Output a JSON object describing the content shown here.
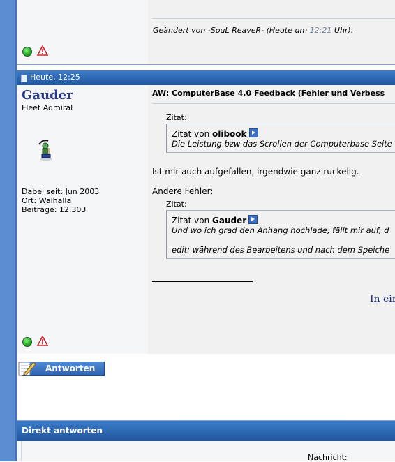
{
  "previous_post": {
    "edit_prefix": "Geändert von -SouL ReaveR- (Heute um ",
    "edit_time": "12:21",
    "edit_suffix": " Uhr)."
  },
  "post": {
    "date": "Heute, 12:25",
    "user": {
      "name": "Gauder",
      "title": "Fleet Admiral",
      "joined": "Dabei seit: Jun 2003",
      "location": "Ort: Walhalla",
      "posts": "Beiträge: 12.303"
    },
    "title": "AW: ComputerBase 4.0 Feedback (Fehler und Verbess",
    "quote1": {
      "label": "Zitat:",
      "prefix": "Zitat von ",
      "author": "olibook",
      "text": "Die Leistung bzw das Scrollen der Computerbase Seite"
    },
    "paragraph1": "Ist mir auch aufgefallen, irgendwie ganz ruckelig.",
    "paragraph2": "Andere Fehler:",
    "quote2": {
      "label": "Zitat:",
      "prefix": "Zitat von ",
      "author": "Gauder",
      "line1": "Und wo ich grad den Anhang hochlade, fällt mir auf, d",
      "line2": "edit: während des Bearbeitens und nach dem Speiche"
    },
    "signature": "In ein"
  },
  "reply_button": "Antworten",
  "direct_reply": {
    "title": "Direkt antworten",
    "message_label": "Nachricht:"
  },
  "colors": {
    "header_blue": "#20569e",
    "username": "#2b3a86",
    "status_online": "#22b022",
    "warning_red": "#d0202a"
  },
  "icons": [
    "status-online-icon",
    "report-post-icon",
    "document-icon",
    "quote-link-arrow-icon",
    "pencil-icon"
  ]
}
